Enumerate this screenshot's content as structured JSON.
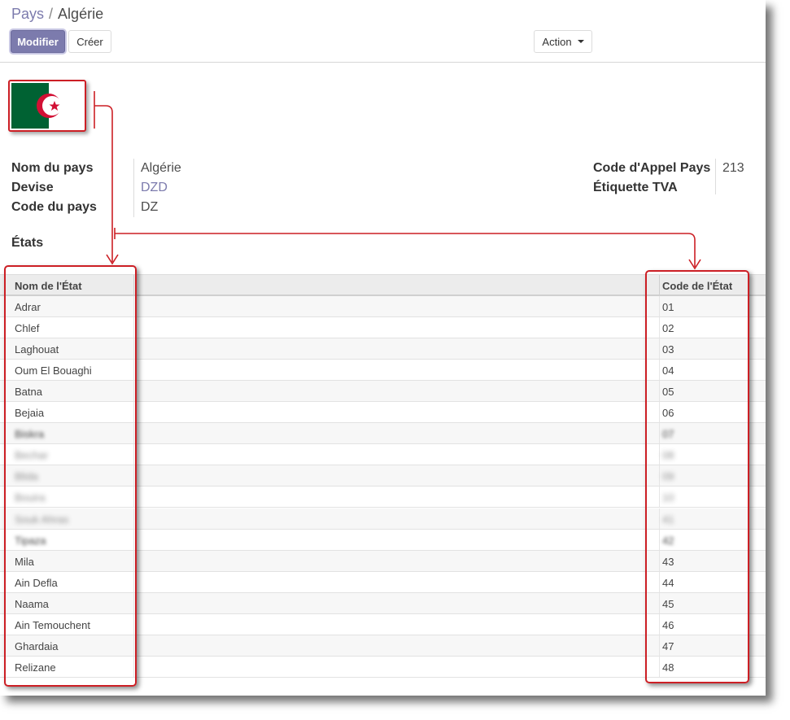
{
  "breadcrumb": {
    "parent": "Pays",
    "separator": "/",
    "current": "Algérie"
  },
  "buttons": {
    "edit": "Modifier",
    "create": "Créer",
    "action": "Action"
  },
  "flag": {
    "green": "#006233",
    "white": "#ffffff",
    "red": "#d21034"
  },
  "fields": {
    "country_name_label": "Nom du pays",
    "country_name_value": "Algérie",
    "currency_label": "Devise",
    "currency_value": "DZD",
    "country_code_label": "Code du pays",
    "country_code_value": "DZ",
    "phone_code_label": "Code d'Appel Pays",
    "phone_code_value": "213",
    "vat_label": "Étiquette TVA",
    "vat_value": ""
  },
  "states_label": "États",
  "table": {
    "col_name": "Nom de l'État",
    "col_code": "Code de l'État",
    "rows": [
      {
        "name": "Adrar",
        "code": "01",
        "blur": ""
      },
      {
        "name": "Chlef",
        "code": "02",
        "blur": ""
      },
      {
        "name": "Laghouat",
        "code": "03",
        "blur": ""
      },
      {
        "name": "Oum El Bouaghi",
        "code": "04",
        "blur": ""
      },
      {
        "name": "Batna",
        "code": "05",
        "blur": ""
      },
      {
        "name": "Bejaia",
        "code": "06",
        "blur": ""
      },
      {
        "name": "Biskra",
        "code": "07",
        "blur": "light"
      },
      {
        "name": "Bechar",
        "code": "08",
        "blur": "strong"
      },
      {
        "name": "Blida",
        "code": "09",
        "blur": "strong"
      },
      {
        "name": "Bouira",
        "code": "10",
        "blur": "strong"
      },
      {
        "name": "Souk Ahras",
        "code": "41",
        "blur": "strong"
      },
      {
        "name": "Tipaza",
        "code": "42",
        "blur": "light"
      },
      {
        "name": "Mila",
        "code": "43",
        "blur": ""
      },
      {
        "name": "Ain Defla",
        "code": "44",
        "blur": ""
      },
      {
        "name": "Naama",
        "code": "45",
        "blur": ""
      },
      {
        "name": "Ain Temouchent",
        "code": "46",
        "blur": ""
      },
      {
        "name": "Ghardaia",
        "code": "47",
        "blur": ""
      },
      {
        "name": "Relizane",
        "code": "48",
        "blur": ""
      }
    ]
  },
  "colors": {
    "brand": "#7c7bad",
    "annotation": "#cc1f25"
  }
}
